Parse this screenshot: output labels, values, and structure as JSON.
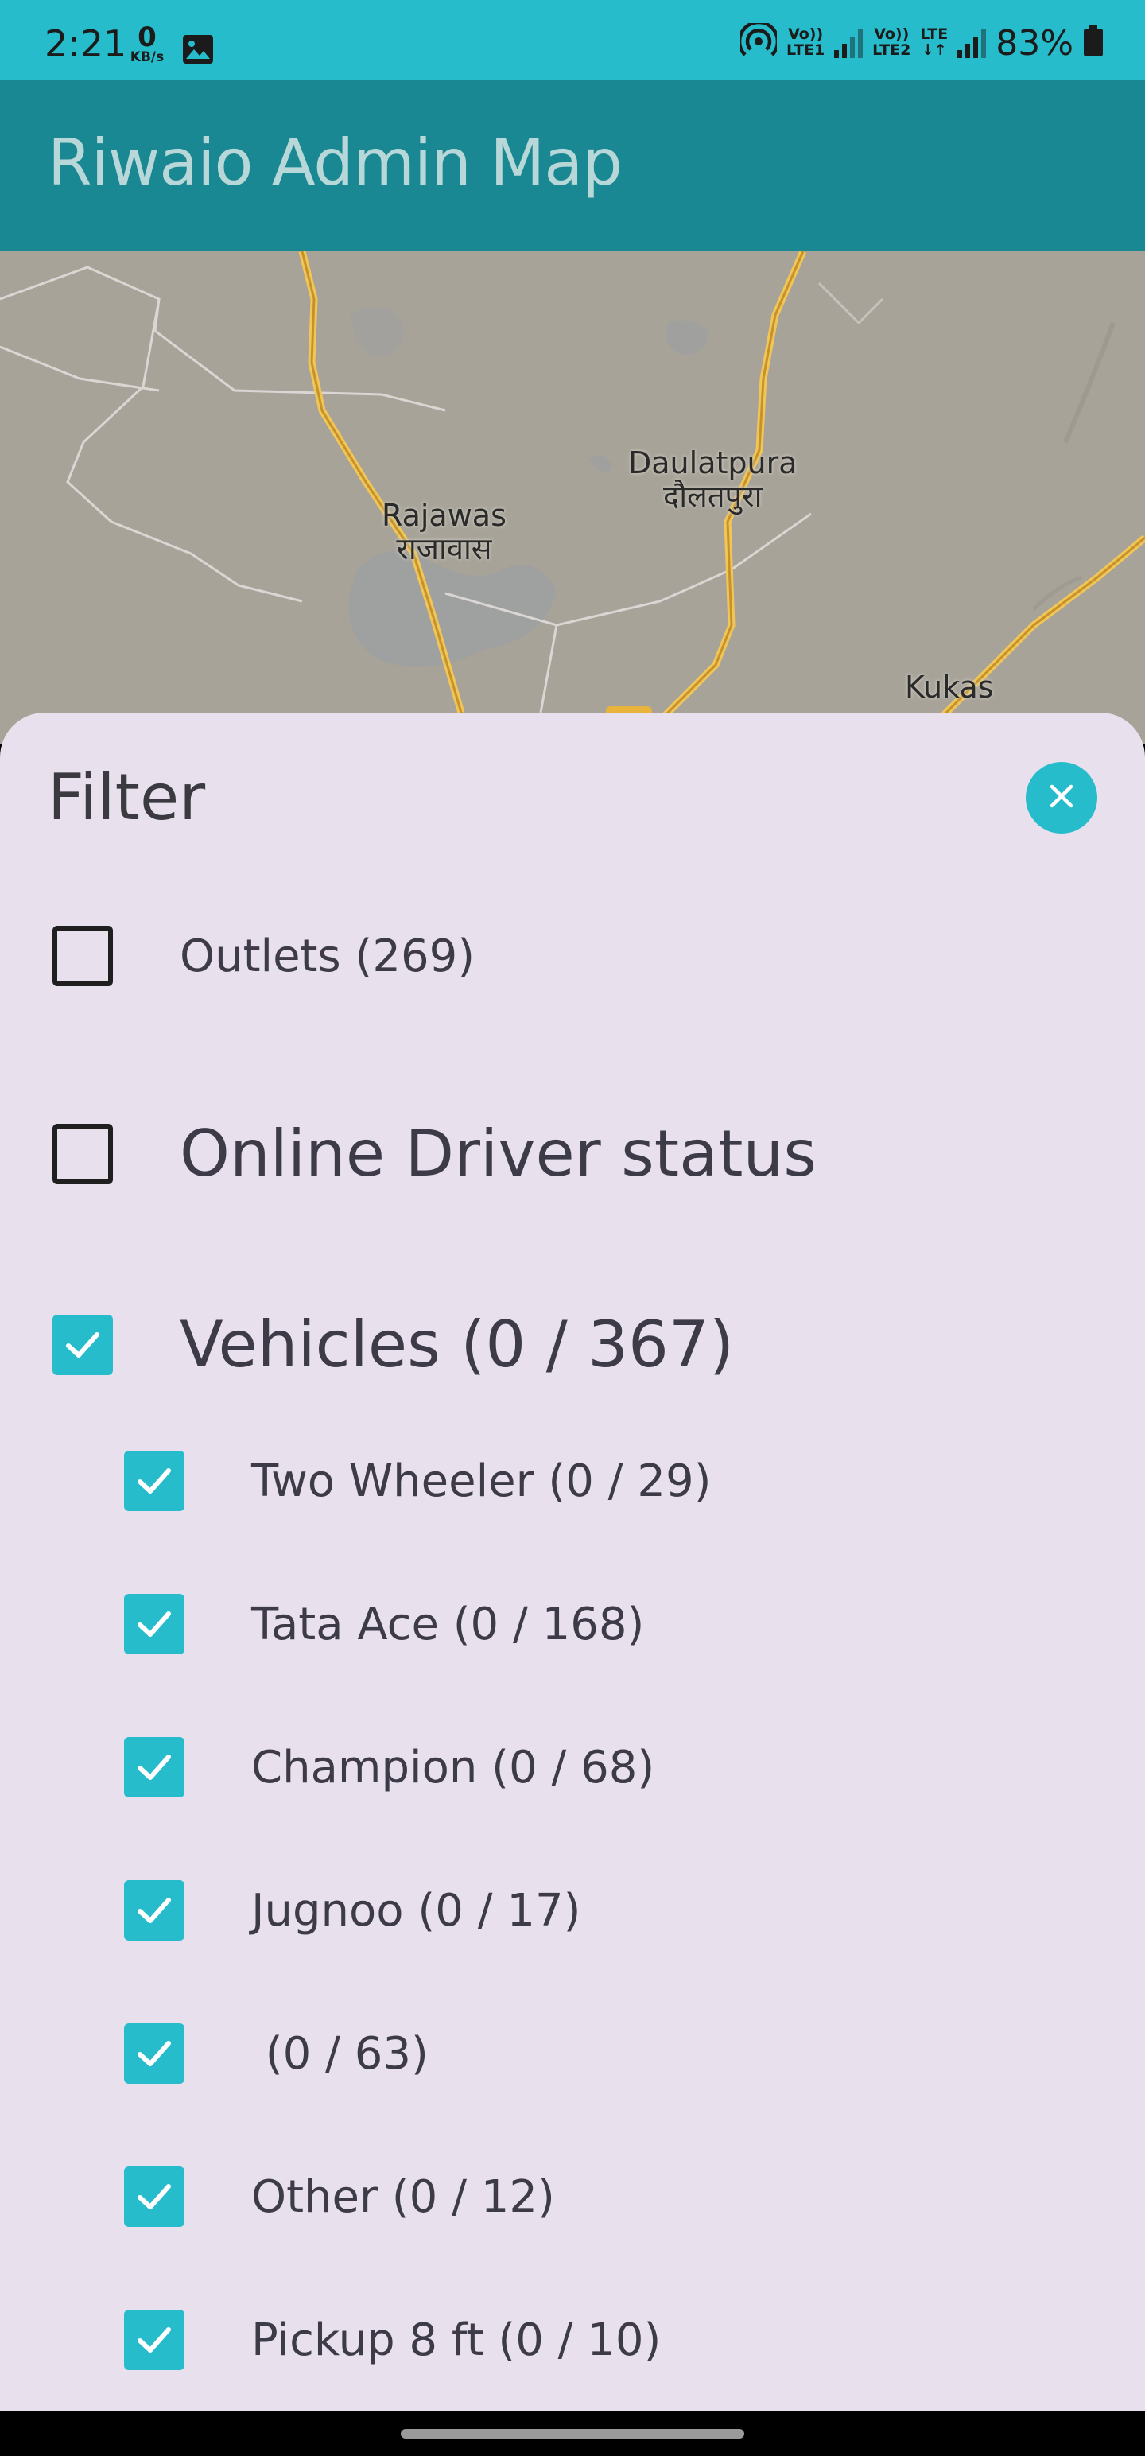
{
  "status_bar": {
    "time": "2:21",
    "data_speed_value": "0",
    "data_speed_unit": "KB/s",
    "sim1_label_top": "Vo))",
    "sim1_label_bottom": "LTE1",
    "sim2_label_top": "Vo))",
    "sim2_label_bottom": "LTE2",
    "network_type": "LTE",
    "battery_percent": "83%",
    "icons": [
      "gallery-icon",
      "hotspot-icon",
      "signal-icon",
      "signal-icon",
      "battery-icon"
    ]
  },
  "app_bar": {
    "title": "Riwaio Admin Map"
  },
  "map": {
    "labels": [
      {
        "line1": "Rajawas",
        "line2": "राजावास"
      },
      {
        "line1": "Daulatpura",
        "line2": "दौलतपुरा"
      },
      {
        "line1": "Kukas",
        "line2": ""
      }
    ]
  },
  "filter": {
    "title": "Filter",
    "close_icon": "close-icon",
    "outlets": {
      "label": "Outlets (269)",
      "checked": false
    },
    "online_driver": {
      "label": "Online Driver status",
      "checked": false
    },
    "vehicles": {
      "label": "Vehicles (0 / 367)",
      "checked": true,
      "types": [
        {
          "label": "Two Wheeler (0 / 29)",
          "checked": true
        },
        {
          "label": "Tata Ace (0 / 168)",
          "checked": true
        },
        {
          "label": "Champion (0 / 68)",
          "checked": true
        },
        {
          "label": "Jugnoo (0 / 17)",
          "checked": true
        },
        {
          "label": " (0 / 63)",
          "checked": true
        },
        {
          "label": "Other (0 / 12)",
          "checked": true
        },
        {
          "label": "Pickup 8 ft (0 / 10)",
          "checked": true
        }
      ]
    }
  },
  "colors": {
    "accent": "#26bccb",
    "app_bar": "#198892",
    "sheet_bg": "#e8e0ed",
    "map_bg": "#a7a399",
    "road": "#d4a33a"
  }
}
